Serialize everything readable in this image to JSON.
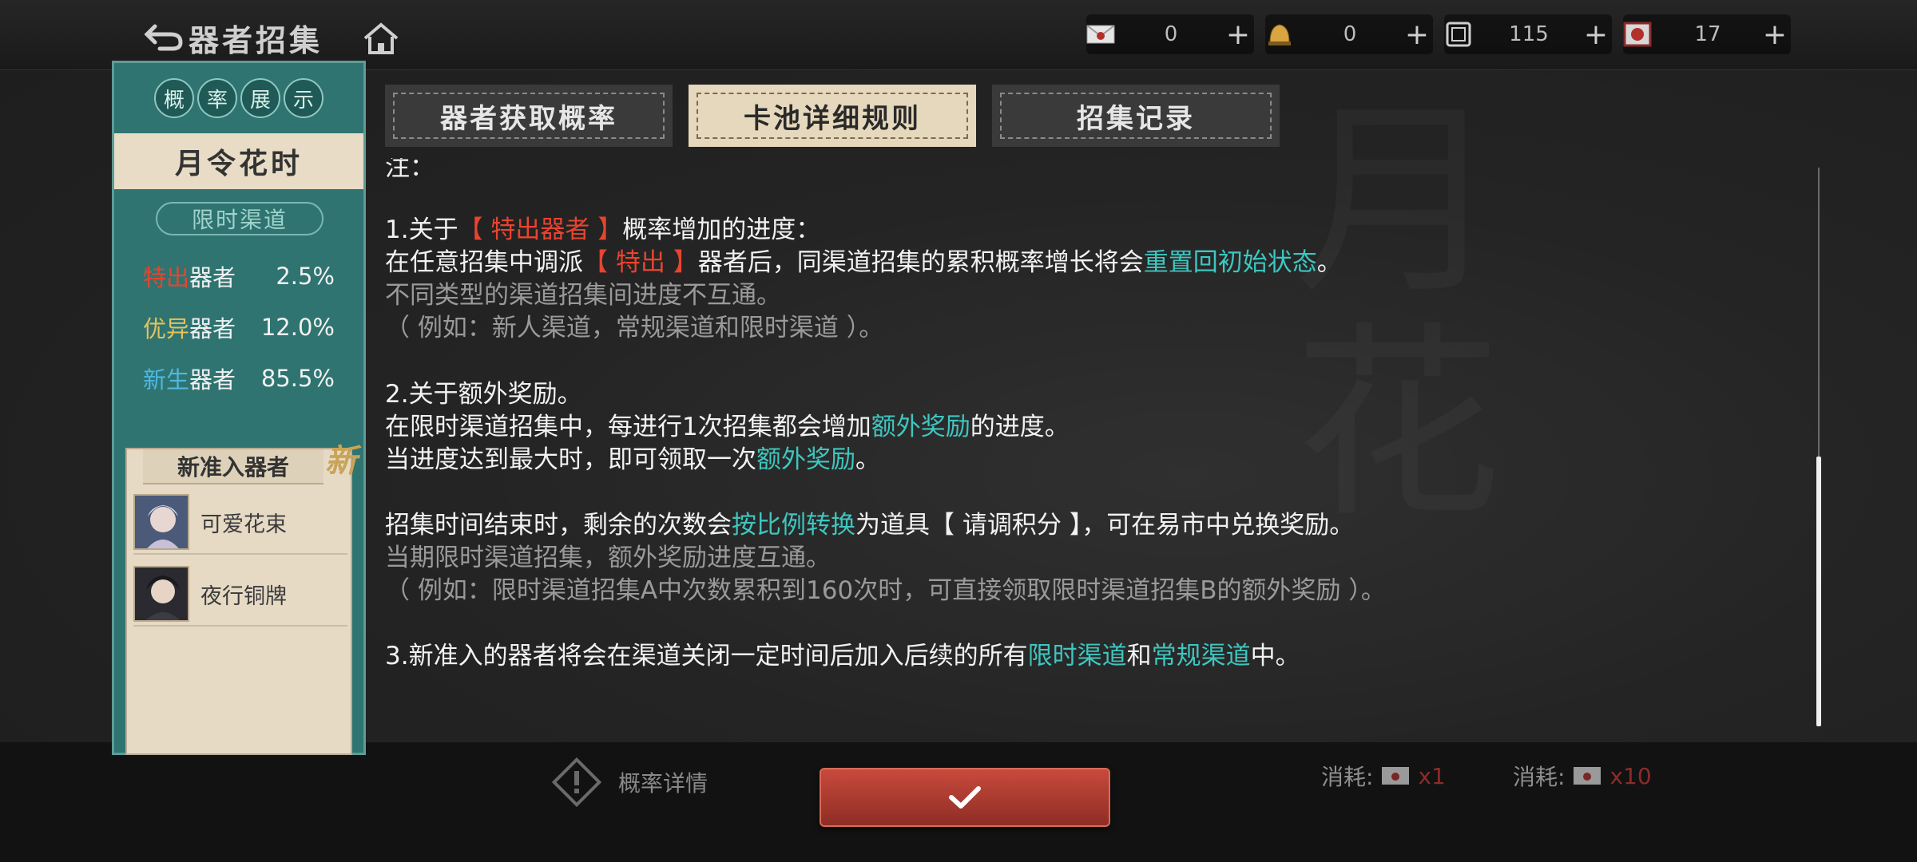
{
  "header": {
    "title": "器者招集",
    "currencies": [
      {
        "icon": "letter-icon",
        "value": "0"
      },
      {
        "icon": "bell-icon",
        "value": "0"
      },
      {
        "icon": "scroll-icon",
        "value": "115"
      },
      {
        "icon": "ticket-icon",
        "value": "17"
      }
    ],
    "plus_label": "+"
  },
  "left_panel": {
    "header_chars": [
      "概",
      "率",
      "展",
      "示"
    ],
    "banner_title": "月令花时",
    "channel": "限时渠道",
    "rates": [
      {
        "tag": "特出",
        "kind": "器者",
        "percent": "2.5%",
        "color": "#e8442f"
      },
      {
        "tag": "优异",
        "kind": "器者",
        "percent": "12.0%",
        "color": "#e7c25a"
      },
      {
        "tag": "新生",
        "kind": "器者",
        "percent": "85.5%",
        "color": "#4fb8e0"
      }
    ],
    "new_section_title": "新准入器者",
    "new_badge": "新",
    "new_characters": [
      "可爱花束",
      "夜行铜牌"
    ]
  },
  "tabs": [
    {
      "label": "器者获取概率",
      "active": false
    },
    {
      "label": "卡池详细规则",
      "active": true
    },
    {
      "label": "招集记录",
      "active": false
    }
  ],
  "rules": {
    "partial_top": "注：",
    "s1_title_pre": "1.关于",
    "s1_title_red": "【 特出器者 】",
    "s1_title_post": "概率增加的进度：",
    "s1_l1_pre": "在任意招集中调派",
    "s1_l1_red": "【 特出 】",
    "s1_l1_mid": "器者后，同渠道招集的累积概率增长将会",
    "s1_l1_teal": "重置回初始状态",
    "s1_l1_post": "。",
    "s1_l2": "不同类型的渠道招集间进度不互通。",
    "s1_l3": "（ 例如：新人渠道，常规渠道和限时渠道 ）。",
    "s2_title": "2.关于额外奖励。",
    "s2_l1_pre": "在限时渠道招集中，每进行1次招集都会增加",
    "s2_l1_teal": "额外奖励",
    "s2_l1_post": "的进度。",
    "s2_l2_pre": "当进度达到最大时，即可领取一次",
    "s2_l2_teal": "额外奖励",
    "s2_l2_post": "。",
    "s2_l3_pre": "招集时间结束时，剩余的次数会",
    "s2_l3_teal": "按比例转换",
    "s2_l3_post": "为道具【 请调积分 】，可在易市中兑换奖励。",
    "s2_l4": "当期限时渠道招集，额外奖励进度互通。",
    "s2_l5": "（ 例如：限时渠道招集A中次数累积到160次时，可直接领取限时渠道招集B的额外奖励 ）。",
    "s3_pre": "3.新准入的器者将会在渠道关闭一定时间后加入后续的所有",
    "s3_teal1": "限时渠道",
    "s3_mid": "和",
    "s3_teal2": "常规渠道",
    "s3_post": "中。"
  },
  "bottom": {
    "prob_detail": "概率详情",
    "cost_label": "消耗:",
    "cost_1": "x1",
    "cost_10": "x10"
  },
  "colors": {
    "red": "#e8442f",
    "teal": "#3ec6c0",
    "panel_teal": "#2f7471",
    "confirm_red": "#b23c30"
  }
}
